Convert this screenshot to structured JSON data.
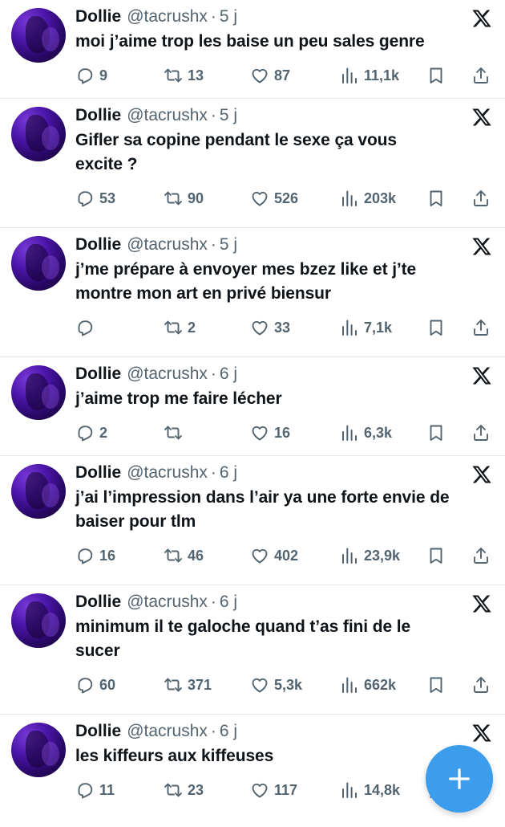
{
  "colors": {
    "accent": "#3d9ded",
    "text": "#0f1419",
    "muted": "#536471",
    "avatar": "#4a15a8"
  },
  "fab": {
    "icon": "plus-icon"
  },
  "tweets": [
    {
      "name": "Dollie",
      "handle": "@tacrushx",
      "sep": "·",
      "time": "5 j",
      "text": "moi j’aime trop les baise un peu sales genre",
      "replies": "9",
      "retweets": "13",
      "likes": "87",
      "views": "11,1k"
    },
    {
      "name": "Dollie",
      "handle": "@tacrushx",
      "sep": "·",
      "time": "5 j",
      "text": "Gifler sa copine pendant le sexe ça vous\nexcite ?",
      "replies": "53",
      "retweets": "90",
      "likes": "526",
      "views": "203k"
    },
    {
      "name": "Dollie",
      "handle": "@tacrushx",
      "sep": "·",
      "time": "5 j",
      "text": "j’me prépare à envoyer mes bzez like et j’te\nmontre mon art en privé biensur",
      "replies": "",
      "retweets": "2",
      "likes": "33",
      "views": "7,1k"
    },
    {
      "name": "Dollie",
      "handle": "@tacrushx",
      "sep": "·",
      "time": "6 j",
      "text": "j’aime trop me faire lécher",
      "replies": "2",
      "retweets": "",
      "likes": "16",
      "views": "6,3k"
    },
    {
      "name": "Dollie",
      "handle": "@tacrushx",
      "sep": "·",
      "time": "6 j",
      "text": "j’ai l’impression dans l’air ya une forte envie de\nbaiser pour tlm",
      "replies": "16",
      "retweets": "46",
      "likes": "402",
      "views": "23,9k"
    },
    {
      "name": "Dollie",
      "handle": "@tacrushx",
      "sep": "·",
      "time": "6 j",
      "text": "minimum il te galoche quand t’as fini de le\nsucer",
      "replies": "60",
      "retweets": "371",
      "likes": "5,3k",
      "views": "662k"
    },
    {
      "name": "Dollie",
      "handle": "@tacrushx",
      "sep": "·",
      "time": "6 j",
      "text": "les kiffeurs aux kiffeuses",
      "replies": "11",
      "retweets": "23",
      "likes": "117",
      "views": "14,8k"
    }
  ]
}
